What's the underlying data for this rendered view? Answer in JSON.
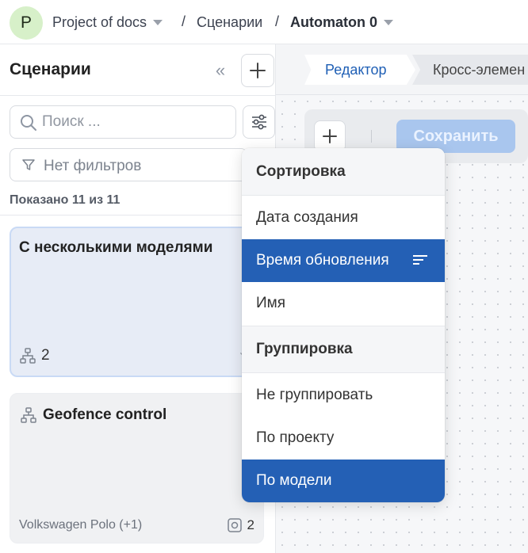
{
  "topbar": {
    "avatar_letter": "P",
    "project": "Project of docs",
    "separator": "/",
    "section": "Сценарии",
    "automaton": "Automaton 0"
  },
  "sidebar": {
    "title": "Сценарии",
    "search_placeholder": "Поиск ...",
    "filters_label": "Нет фильтров",
    "count_label": "Показано 11 из 11",
    "cards": [
      {
        "title": "С несколькими моделями",
        "models_count": "2"
      },
      {
        "title": "Geofence control",
        "footer_left": "Volkswagen Polo (+1)",
        "footer_count": "2"
      }
    ]
  },
  "canvas": {
    "tabs": [
      "Редактор",
      "Кросс-элемен"
    ],
    "save_label": "Сохранить"
  },
  "dropdown": {
    "sort_header": "Сортировка",
    "sort_items": [
      "Дата создания",
      "Время обновления",
      "Имя"
    ],
    "group_header": "Группировка",
    "group_items": [
      "Не группировать",
      "По проекту",
      "По модели"
    ]
  },
  "colors": {
    "accent": "#2460b5",
    "active_card_bg": "#e7ecf6",
    "save_disabled": "#a9c6ee",
    "avatar_bg": "#d7f0c9"
  }
}
